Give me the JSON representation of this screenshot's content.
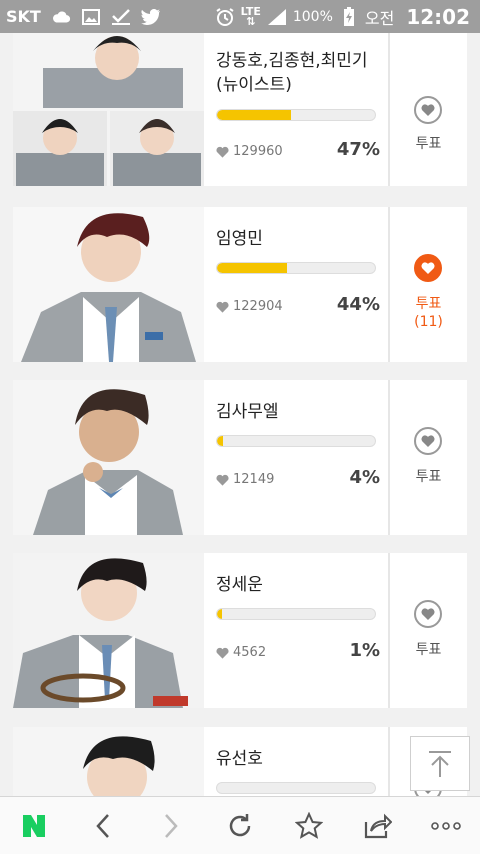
{
  "status_bar": {
    "carrier": "SKT",
    "network": "LTE",
    "battery_percent": "100%",
    "ampm": "오전",
    "time": "12:02"
  },
  "colors": {
    "accent_orange": "#f05a14",
    "bar_yellow": "#f5c400"
  },
  "candidates": [
    {
      "name_line1": "강동호,김종현,최민기",
      "name_line2": "(뉴이스트)",
      "votes": "129960",
      "percent_label": "47%",
      "percent": 47,
      "vote_label": "투표",
      "voted": false,
      "vote_count": ""
    },
    {
      "name_line1": "임영민",
      "name_line2": "",
      "votes": "122904",
      "percent_label": "44%",
      "percent": 44,
      "vote_label": "투표",
      "voted": true,
      "vote_count": "(11)"
    },
    {
      "name_line1": "김사무엘",
      "name_line2": "",
      "votes": "12149",
      "percent_label": "4%",
      "percent": 4,
      "vote_label": "투표",
      "voted": false,
      "vote_count": ""
    },
    {
      "name_line1": "정세운",
      "name_line2": "",
      "votes": "4562",
      "percent_label": "1%",
      "percent": 1,
      "vote_label": "투표",
      "voted": false,
      "vote_count": ""
    },
    {
      "name_line1": "유선호",
      "name_line2": "",
      "votes": "",
      "percent_label": "",
      "percent": 0,
      "vote_label": "",
      "voted": false,
      "vote_count": ""
    }
  ],
  "bottom_nav": {
    "items": [
      "naver-home",
      "back",
      "forward",
      "refresh",
      "bookmark",
      "share",
      "more"
    ]
  }
}
